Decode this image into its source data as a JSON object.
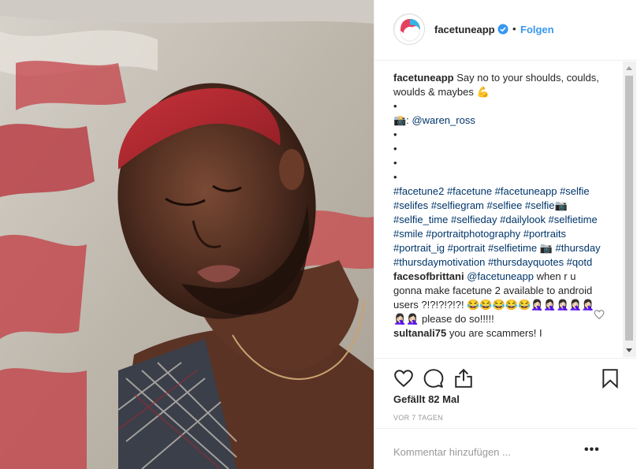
{
  "post": {
    "username": "facetuneapp",
    "separator": "•",
    "follow_label": "Folgen"
  },
  "caption": {
    "author": "facetuneapp",
    "text_1": "Say no to your shoulds, coulds, woulds & maybes 💪",
    "bullet": "•",
    "credit_prefix": "📸:",
    "credit_handle": "@waren_ross",
    "hashtags_1": "#facetune2 #facetune #facetuneapp #selfie #selifes #selfiegram #selfiee #selfie📷 #selfie_time #selfieday #dailylook #selfietime #smile #portraitphotography #portraits #portrait_ig #portrait #selfietime 📷 #thursday #thursdaymotivation #thursdayquotes #qotd"
  },
  "comments": [
    {
      "author": "facesofbrittani",
      "mention": "@facetuneapp",
      "text": " when r u gonna make facetune 2 available to android users ?!?!?!?!?! 😂😂😂😂😂🤦🏻‍♀️🤦🏻‍♀️🤦🏻‍♀️🤦🏻‍♀️🤦🏻‍♀️🤦🏻‍♀️🤦🏻‍♀️ please do so!!!!!"
    },
    {
      "author": "sultanali75",
      "text": " you are scammers! I"
    }
  ],
  "stats": {
    "likes": "Gefällt 82 Mal",
    "time": "VOR 7 TAGEN"
  },
  "composer": {
    "placeholder": "Kommentar hinzufügen ...",
    "more": "•••"
  },
  "icons": {
    "like": "heart-icon",
    "comment": "comment-icon",
    "share": "share-icon",
    "save": "bookmark-icon",
    "verified": "verified-badge-icon"
  },
  "colors": {
    "link": "#3897f0",
    "hashtag": "#003569",
    "text": "#262626",
    "muted": "#999999"
  }
}
